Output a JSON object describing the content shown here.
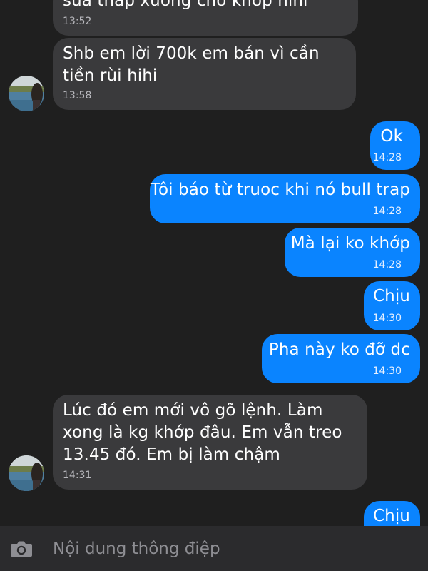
{
  "messages": [
    {
      "direction": "incoming",
      "text": "sửa thấp xuống cho khớp hihi",
      "time": "13:52"
    },
    {
      "direction": "incoming",
      "text": "Shb em lời 700k em bán vì cần tiền rùi hihi",
      "time": "13:58"
    },
    {
      "direction": "outgoing",
      "text": "Ok",
      "time": "14:28"
    },
    {
      "direction": "outgoing",
      "text": "Tôi báo từ truoc khi nó bull trap",
      "time": "14:28"
    },
    {
      "direction": "outgoing",
      "text": "Mà lại ko khớp",
      "time": "14:28"
    },
    {
      "direction": "outgoing",
      "text": "Chịu",
      "time": "14:30"
    },
    {
      "direction": "outgoing",
      "text": "Pha này ko đỡ dc",
      "time": "14:30"
    },
    {
      "direction": "incoming",
      "text": "Lúc đó em mới vô gõ lệnh. Làm xong là kg khớp đâu. Em vẫn treo 13.45 đó. Em bị làm chậm",
      "time": "14:31"
    },
    {
      "direction": "outgoing",
      "text": "Chịu",
      "time": ""
    }
  ],
  "composer": {
    "placeholder": "Nội dung thông điệp",
    "camera_icon": "camera-icon"
  },
  "colors": {
    "background": "#1f1f1f",
    "incoming_bubble": "#3a3a3c",
    "outgoing_bubble": "#0a84ff",
    "composer_bar": "#2b2b2d"
  }
}
